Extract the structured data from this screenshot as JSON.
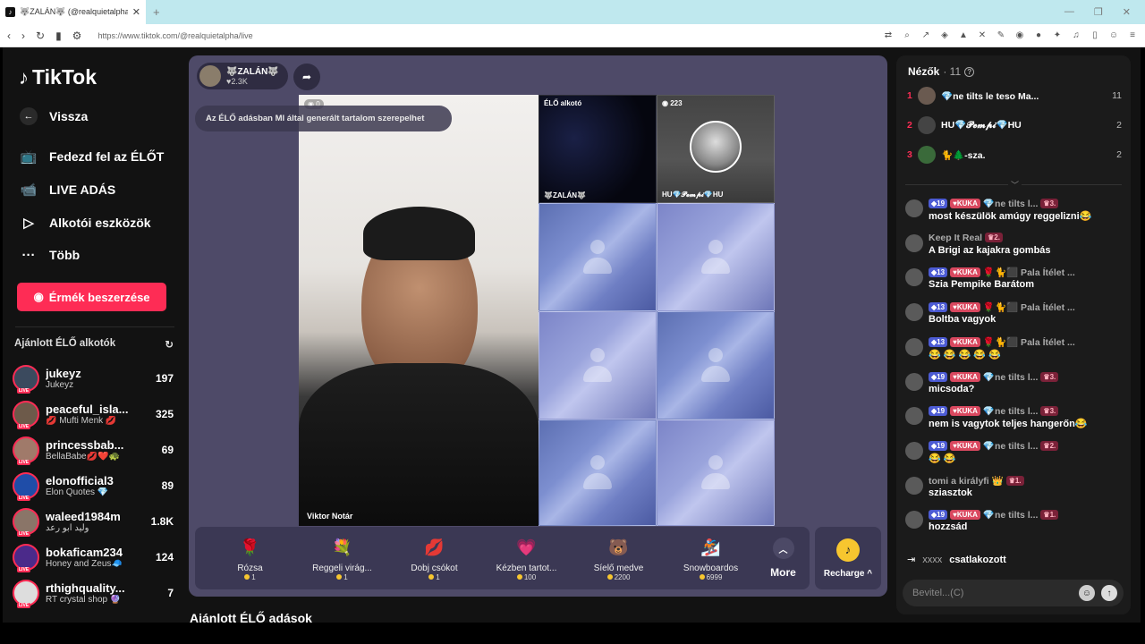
{
  "browser": {
    "tab_title": "🐺ZALÁN🐺 (@realquietalpha",
    "url": "https://www.tiktok.com/@realquietalpha/live",
    "new_tab": "+",
    "close": "✕"
  },
  "sidebar": {
    "logo": "TikTok",
    "back": "Vissza",
    "nav": [
      {
        "label": "Fedezd fel az ÉLŐT",
        "icon": "explore-live-icon"
      },
      {
        "label": "LIVE ADÁS",
        "icon": "camera-icon"
      },
      {
        "label": "Alkotói eszközök",
        "icon": "creator-tools-icon"
      },
      {
        "label": "Több",
        "icon": "more-dots-icon"
      }
    ],
    "coin_button": "Érmék beszerzése",
    "recommended_title": "Ajánlott ÉLŐ alkotók",
    "creators": [
      {
        "name": "jukeyz",
        "sub": "Jukeyz",
        "count": "197",
        "color": "#3b4a5e"
      },
      {
        "name": "peaceful_isla...",
        "sub": "💋 Mufti Menk 💋",
        "count": "325",
        "color": "#6d5a4a"
      },
      {
        "name": "princessbab...",
        "sub": "BellaBabe💋❤️🐢",
        "count": "69",
        "color": "#a07a6a"
      },
      {
        "name": "elonofficial3",
        "sub": "Elon Quotes 💎",
        "count": "89",
        "color": "#1f4da8"
      },
      {
        "name": "waleed1984m",
        "sub": "وليد ابو رعد",
        "count": "1.8K",
        "color": "#8a7568"
      },
      {
        "name": "bokaficam234",
        "sub": "Honey and Zeus🧢",
        "count": "124",
        "color": "#4b2a8a"
      },
      {
        "name": "rthighquality...",
        "sub": "RT crystal shop 🔮",
        "count": "7",
        "color": "#ddd"
      }
    ]
  },
  "stream": {
    "host_name": "🐺ZALÁN🐺",
    "host_likes": "♥2.3K",
    "ai_notice": "Az ÉLŐ adásban MI által generált tartalom szerepelhet",
    "main_viewers": "0",
    "main_name": "Viktor Notár",
    "cell_top_label": "ÉLŐ alkotó",
    "cell_top_name": "🐺ZALÁN🐺",
    "guest_viewers": "223",
    "guest_name": "HU💎𝓟𝓮𝓶𝓹𝓲💎HU",
    "below_title": "Ajánlott ÉLŐ adások"
  },
  "gifts": [
    {
      "name": "Rózsa",
      "price": "1",
      "icon": "🌹"
    },
    {
      "name": "Reggeli virág...",
      "price": "1",
      "icon": "💐"
    },
    {
      "name": "Dobj csókot",
      "price": "1",
      "icon": "💋"
    },
    {
      "name": "Kézben tartot...",
      "price": "100",
      "icon": "💗"
    },
    {
      "name": "Síelő medve",
      "price": "2200",
      "icon": "🐻"
    },
    {
      "name": "Snowboardos",
      "price": "6999",
      "icon": "🏂"
    }
  ],
  "more_label": "More",
  "recharge_label": "Recharge ^",
  "panel": {
    "viewers_title": "Nézők",
    "viewers_count": "· 11",
    "top_viewers": [
      {
        "rank": "1",
        "name": "💎ne tilts le teso Ma...",
        "score": "11"
      },
      {
        "rank": "2",
        "name": "HU💎𝓟𝓮𝓶𝓹𝓲💎HU",
        "score": "2"
      },
      {
        "rank": "3",
        "name": "🐈🌲-sza.",
        "score": "2"
      }
    ],
    "messages": [
      {
        "lvl": "19",
        "kuka": "KUKA",
        "user": "💎ne tilts l...",
        "rank": "3.",
        "text": "most készülök amúgy reggelizni😂"
      },
      {
        "lvl": "",
        "kuka": "",
        "user": "Keep It Real",
        "rank": "2.",
        "text": "A Brigi az kajakra gombás"
      },
      {
        "lvl": "13",
        "kuka": "KUKA",
        "user": "🌹🐈⬛ Pala Ítélet ...",
        "rank": "",
        "text": "Szia Pempike Barátom"
      },
      {
        "lvl": "13",
        "kuka": "KUKA",
        "user": "🌹🐈⬛ Pala Ítélet ...",
        "rank": "",
        "text": "Boltba vagyok"
      },
      {
        "lvl": "13",
        "kuka": "KUKA",
        "user": "🌹🐈⬛ Pala Ítélet ...",
        "rank": "",
        "text": "😂 😂 😂 😂 😂"
      },
      {
        "lvl": "19",
        "kuka": "KUKA",
        "user": "💎ne tilts l...",
        "rank": "3.",
        "text": "micsoda?"
      },
      {
        "lvl": "19",
        "kuka": "KUKA",
        "user": "💎ne tilts l...",
        "rank": "3.",
        "text": "nem is vagytok teljes hangerőn😂"
      },
      {
        "lvl": "19",
        "kuka": "KUKA",
        "user": "💎ne tilts l...",
        "rank": "2.",
        "text": "😂 😂"
      },
      {
        "lvl": "",
        "kuka": "",
        "user": "tomi a királyfi 👑",
        "rank": "1.",
        "text": "sziasztok"
      },
      {
        "lvl": "19",
        "kuka": "KUKA",
        "user": "💎ne tilts l...",
        "rank": "1.",
        "text": "hozzsád"
      }
    ],
    "joined_user": "xxxx",
    "joined_text": "csatlakozott",
    "input_placeholder": "Bevitel...(C)"
  }
}
